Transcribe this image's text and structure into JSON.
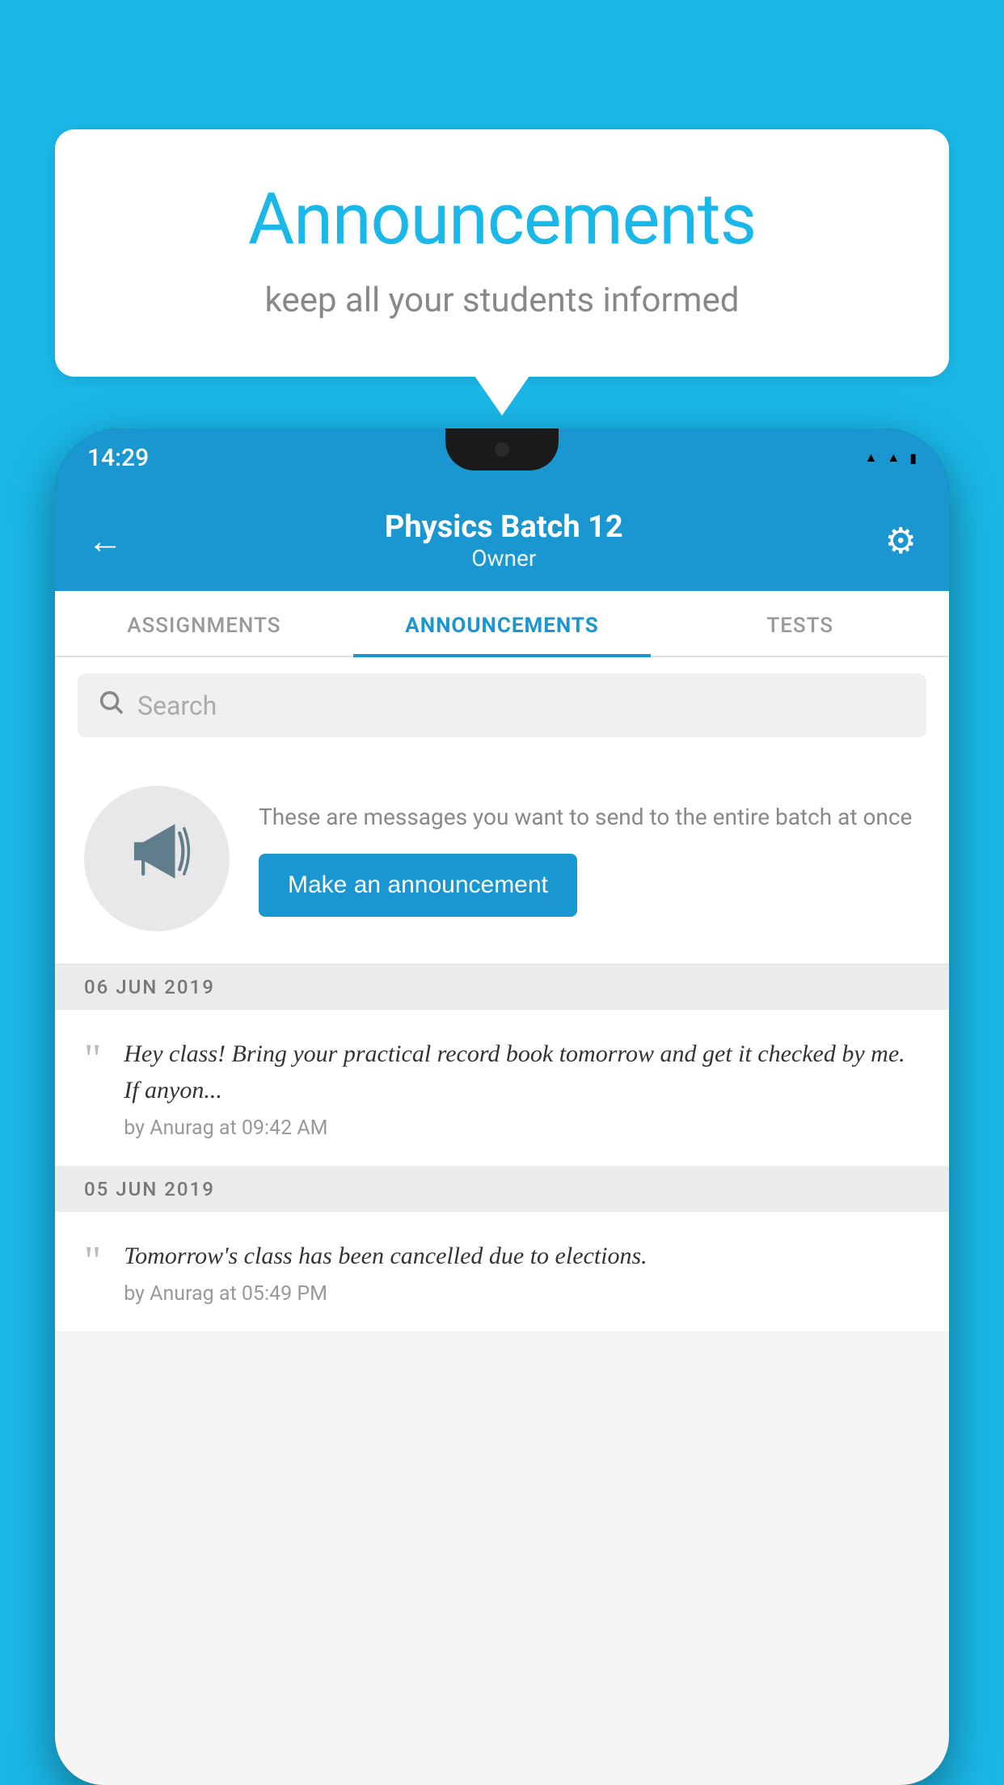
{
  "background": {
    "color": "#1ab8e8"
  },
  "speech_bubble": {
    "title": "Announcements",
    "subtitle": "keep all your students informed"
  },
  "phone": {
    "status_bar": {
      "time": "14:29",
      "icons": [
        "wifi",
        "signal",
        "battery"
      ]
    },
    "header": {
      "title": "Physics Batch 12",
      "subtitle": "Owner",
      "back_label": "←",
      "gear_label": "⚙"
    },
    "tabs": [
      {
        "label": "ASSIGNMENTS",
        "active": false
      },
      {
        "label": "ANNOUNCEMENTS",
        "active": true
      },
      {
        "label": "TESTS",
        "active": false
      }
    ],
    "search": {
      "placeholder": "Search"
    },
    "promo": {
      "description": "These are messages you want to send to the entire batch at once",
      "button_label": "Make an announcement"
    },
    "announcements": [
      {
        "date": "06  JUN  2019",
        "text": "Hey class! Bring your practical record book tomorrow and get it checked by me. If anyon...",
        "meta": "by Anurag at 09:42 AM"
      },
      {
        "date": "05  JUN  2019",
        "text": "Tomorrow's class has been cancelled due to elections.",
        "meta": "by Anurag at 05:49 PM"
      }
    ]
  }
}
